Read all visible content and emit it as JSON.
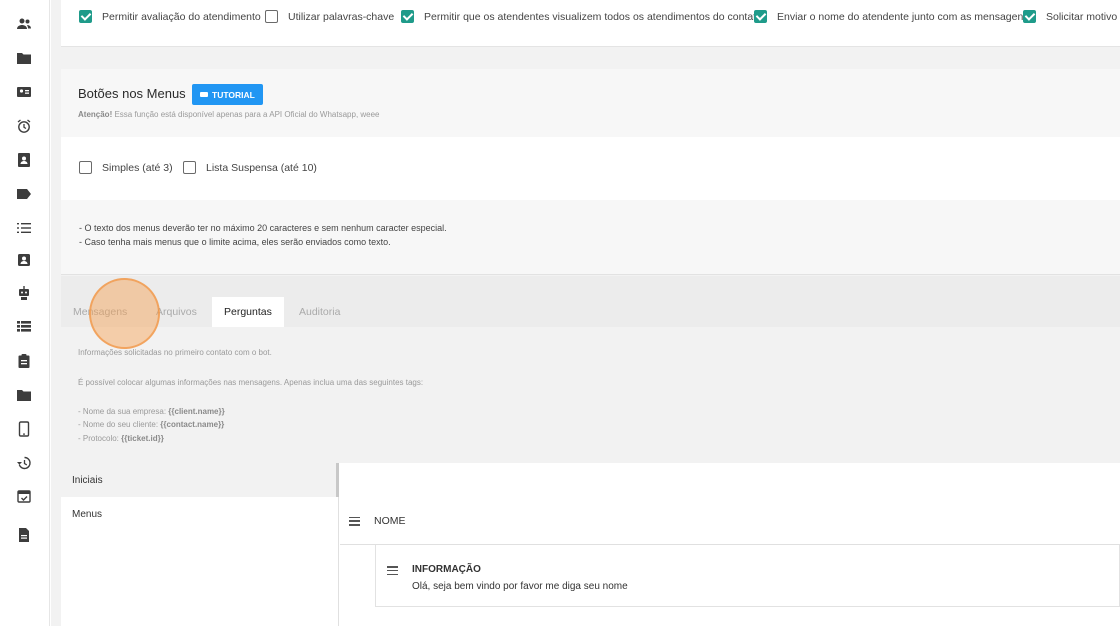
{
  "sidebar": {
    "items": [
      {
        "icon": "people-icon"
      },
      {
        "icon": "folder-account-icon"
      },
      {
        "icon": "contact-card-icon"
      },
      {
        "icon": "alarm-clock-icon"
      },
      {
        "icon": "contacts-book-icon"
      },
      {
        "icon": "tag-icon"
      },
      {
        "icon": "list-icon"
      },
      {
        "icon": "account-box-icon"
      },
      {
        "icon": "robot-icon"
      },
      {
        "icon": "view-list-icon"
      },
      {
        "icon": "clipboard-icon"
      },
      {
        "icon": "folder-icon"
      },
      {
        "icon": "cellphone-icon"
      },
      {
        "icon": "history-icon"
      },
      {
        "icon": "calendar-check-icon"
      },
      {
        "icon": "file-document-icon"
      }
    ]
  },
  "options": [
    {
      "label": "Permitir avaliação do atendimento",
      "checked": true
    },
    {
      "label": "Utilizar palavras-chave",
      "checked": false
    },
    {
      "label": "Permitir que os atendentes visualizem todos os atendimentos do contato",
      "checked": true
    },
    {
      "label": "Enviar o nome do atendente junto com as mensagens",
      "checked": true
    },
    {
      "label": "Solicitar motivo d",
      "checked": true
    }
  ],
  "menus_section": {
    "title": "Botões nos Menus",
    "tutorial_label": "TUTORIAL",
    "note_bold": "Atenção!",
    "note_text": " Essa função está disponível apenas para a API Oficial do Whatsapp, weee",
    "options": [
      {
        "label": "Simples (até 3)",
        "checked": false
      },
      {
        "label": "Lista Suspensa (até 10)",
        "checked": false
      }
    ],
    "rules": [
      "- O texto dos menus deverão ter no máximo 20 caracteres e sem nenhum caracter especial.",
      "- Caso tenha mais menus que o limite acima, eles serão enviados como texto."
    ]
  },
  "tabs": [
    {
      "label": "Mensagens",
      "active": false
    },
    {
      "label": "Arquivos",
      "active": false
    },
    {
      "label": "Perguntas",
      "active": true
    },
    {
      "label": "Auditoria",
      "active": false
    }
  ],
  "info": {
    "line1": "Informações solicitadas no primeiro contato com o bot.",
    "line2": "É possível colocar algumas informações nas mensagens. Apenas inclua uma das seguintes tags:",
    "tags": [
      {
        "text": "- Nome da sua empresa: ",
        "tag": "{{client.name}}"
      },
      {
        "text": "- Nome do seu cliente: ",
        "tag": "{{contact.name}}"
      },
      {
        "text": "- Protocolo: ",
        "tag": "{{ticket.id}}"
      }
    ]
  },
  "question_groups": [
    {
      "label": "Iniciais",
      "selected": true
    },
    {
      "label": "Menus",
      "selected": false
    }
  ],
  "table": {
    "column_header": "NOME",
    "rows": [
      {
        "label": "INFORMAÇÃO",
        "value": "Olá, seja bem vindo por favor me diga seu nome"
      }
    ]
  },
  "colors": {
    "accent_checkbox": "#1f9b8a",
    "tutorial_button": "#2196f3",
    "click_indicator": "#f7a050"
  }
}
